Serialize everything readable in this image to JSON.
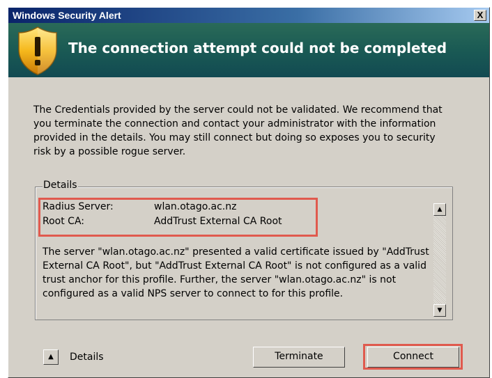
{
  "window": {
    "title": "Windows Security Alert",
    "close_label": "X"
  },
  "banner": {
    "title": "The connection attempt could not be completed",
    "icon": "warning-shield-icon"
  },
  "message": "The Credentials provided by the server could not be validated. We recommend that you terminate the connection and contact your administrator with the information provided in the details. You may still connect but doing so exposes you to security risk by a possible rogue server.",
  "details": {
    "group_label": "Details",
    "rows": [
      {
        "label": "Radius Server:",
        "value": "wlan.otago.ac.nz"
      },
      {
        "label": "Root CA:",
        "value": "AddTrust External CA Root"
      }
    ],
    "description": "The server \"wlan.otago.ac.nz\" presented a valid certificate issued by \"AddTrust External CA Root\", but \"AddTrust External CA Root\" is not configured as a valid trust anchor for this profile. Further, the server \"wlan.otago.ac.nz\" is not configured as a valid NPS server to connect to for this profile.",
    "scroll_up": "▲",
    "scroll_down": "▼"
  },
  "footer": {
    "toggle_icon": "▲",
    "toggle_label": "Details",
    "terminate_label": "Terminate",
    "connect_label": "Connect"
  },
  "colors": {
    "highlight": "#e05a4e",
    "banner": "#1a5a54",
    "titlebar": "#0a246a",
    "dialog_bg": "#d4d0c8"
  }
}
